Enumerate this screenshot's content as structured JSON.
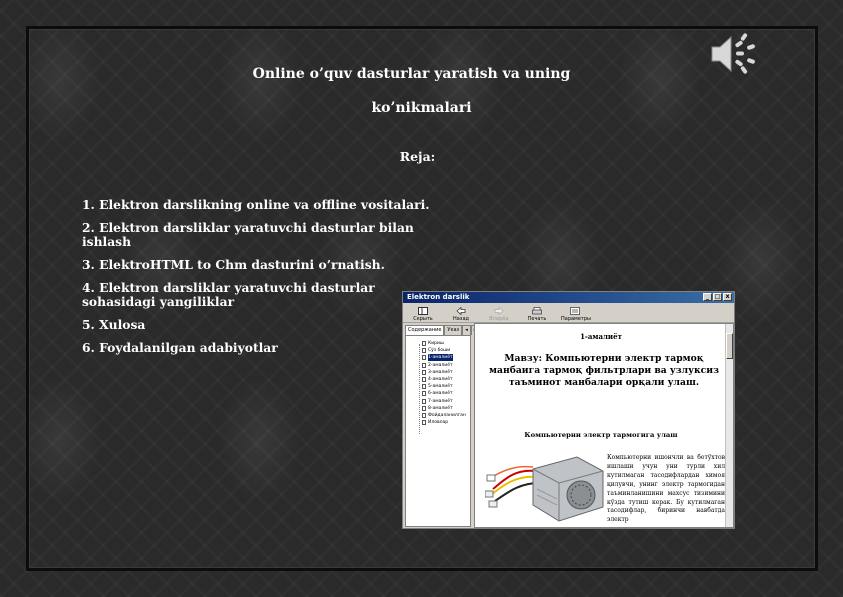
{
  "slide": {
    "title_line1": "Online o’quv dasturlar yaratish  va uning",
    "title_line2": "ko’nikmalari",
    "plan_heading": "Reja:",
    "plan_items": [
      "1.  Elektron darslikning online va offline vositalari.",
      "2.  Elektron darsliklar yaratuvchi dasturlar bilan ishlash",
      "3.  ElektroHTML to Chm dasturini  o’rnatish.",
      "4.  Elektron darsliklar yaratuvchi dasturlar sohasidagi yangiliklar",
      "5.  Xulosa",
      "6.  Foydalanilgan adabiyotlar"
    ]
  },
  "icons": {
    "audio": "speaker-icon"
  },
  "window": {
    "title": "Elektron darslik",
    "controls": [
      "_",
      "□",
      "x"
    ],
    "toolbar": [
      {
        "label": "Скрыть",
        "icon": "hide-icon",
        "enabled": true
      },
      {
        "label": "Назад",
        "icon": "back-icon",
        "enabled": true
      },
      {
        "label": "Вперёд",
        "icon": "forward-icon",
        "enabled": false
      },
      {
        "label": "Печать",
        "icon": "print-icon",
        "enabled": true
      },
      {
        "label": "Параметры",
        "icon": "options-icon",
        "enabled": true
      }
    ],
    "tabs": [
      "Содержание",
      "Указ",
      "◂",
      "▸"
    ],
    "tree": [
      "Кириш",
      "Сўз боши",
      "1-амалиёт",
      "2-амалиёт",
      "3-амалиёт",
      "4-амалиёт",
      "5-амалиёт",
      "6-амалиёт",
      "7-амалиёт",
      "8-амалиёт",
      "Фойдаланилган",
      "Иловлар"
    ],
    "selected_tree_index": 2,
    "content": {
      "heading": "1-амалиёт",
      "topic": "Мавзу: Компьютерни электр тармоқ манбаига тармоқ фильтрлари ва узлуксиз таъминот манбалари орқали улаш.",
      "subheading": "Компьютерни электр тармогига улаш",
      "body": "Компьютерни ишончли ва бетўхтов ишлаши учун уни турли хил кутилмаган тасодифлардан химоя қилувчи, унинг электр тармогидан таъминланишини махсус тизимини кўзда тутиш керак. Бу кутилмаган тасодифлар, биринчи навбатда электр"
    }
  },
  "colors": {
    "slide_text": "#ffffff",
    "title_bar": "#0a246a"
  }
}
